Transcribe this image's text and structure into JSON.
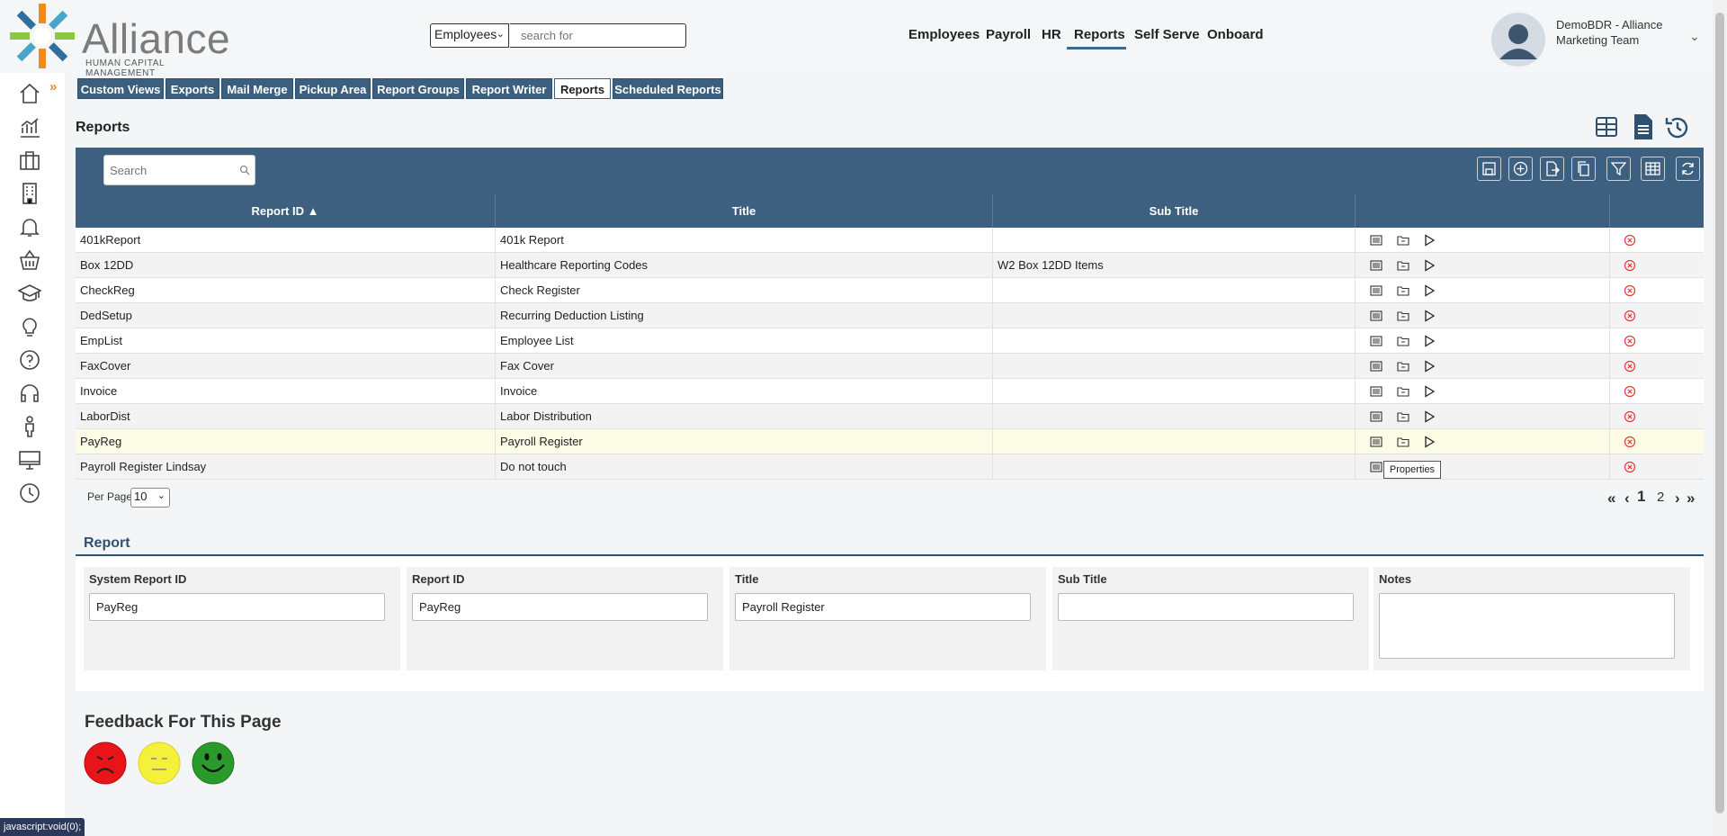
{
  "logo": {
    "name": "Alliance",
    "tagline": "HUMAN CAPITAL MANAGEMENT"
  },
  "search": {
    "category": "Employees",
    "placeholder": "search for"
  },
  "topnav": [
    "Employees",
    "Payroll",
    "HR",
    "Reports",
    "Self Serve",
    "Onboard"
  ],
  "topnav_active": "Reports",
  "user": {
    "line1": "DemoBDR - Alliance",
    "line2": "Marketing Team"
  },
  "sidebar_icons": [
    "home-icon",
    "analytics-icon",
    "briefcase-icon",
    "building-icon",
    "bell-icon",
    "basket-icon",
    "graduation-cap-icon",
    "lightbulb-icon",
    "help-icon",
    "headset-icon",
    "person-icon",
    "monitor-icon",
    "clock-icon"
  ],
  "tabs": [
    "Custom Views",
    "Exports",
    "Mail Merge",
    "Pickup Area",
    "Report Groups",
    "Report Writer",
    "Reports",
    "Scheduled Reports"
  ],
  "active_tab": "Reports",
  "page_title": "Reports",
  "grid": {
    "search_placeholder": "Search",
    "columns": [
      "Report ID ▲",
      "Title",
      "Sub Title"
    ],
    "rows": [
      {
        "id": "401kReport",
        "title": "401k Report",
        "subtitle": ""
      },
      {
        "id": "Box 12DD",
        "title": "Healthcare Reporting Codes",
        "subtitle": "W2 Box 12DD Items"
      },
      {
        "id": "CheckReg",
        "title": "Check Register",
        "subtitle": ""
      },
      {
        "id": "DedSetup",
        "title": "Recurring Deduction Listing",
        "subtitle": ""
      },
      {
        "id": "EmpList",
        "title": "Employee List",
        "subtitle": ""
      },
      {
        "id": "FaxCover",
        "title": "Fax Cover",
        "subtitle": ""
      },
      {
        "id": "Invoice",
        "title": "Invoice",
        "subtitle": ""
      },
      {
        "id": "LaborDist",
        "title": "Labor Distribution",
        "subtitle": ""
      },
      {
        "id": "PayReg",
        "title": "Payroll Register",
        "subtitle": ""
      },
      {
        "id": "Payroll Register Lindsay",
        "title": "Do not touch",
        "subtitle": ""
      }
    ],
    "selected_row": "PayReg",
    "tooltip": "Properties",
    "per_page_label": "Per Page",
    "per_page": "10",
    "pager": {
      "first": "«",
      "prev": "‹",
      "current": "1",
      "other": "2",
      "next": "›",
      "last": "»"
    }
  },
  "report_form": {
    "section_title": "Report",
    "fields": [
      {
        "label": "System Report ID",
        "value": "PayReg"
      },
      {
        "label": "Report ID",
        "value": "PayReg"
      },
      {
        "label": "Title",
        "value": "Payroll Register"
      },
      {
        "label": "Sub Title",
        "value": ""
      },
      {
        "label": "Notes",
        "value": ""
      }
    ]
  },
  "feedback": {
    "title": "Feedback For This Page",
    "faces": [
      "sad-face-icon",
      "neutral-face-icon",
      "happy-face-icon"
    ]
  },
  "status_bar": "javascript:void(0);",
  "colors": {
    "accent": "#3d6080",
    "logo_orange": "#f08a1c",
    "sad": "#e8141a",
    "neutral": "#f5f03a",
    "happy": "#2a9a2a"
  }
}
